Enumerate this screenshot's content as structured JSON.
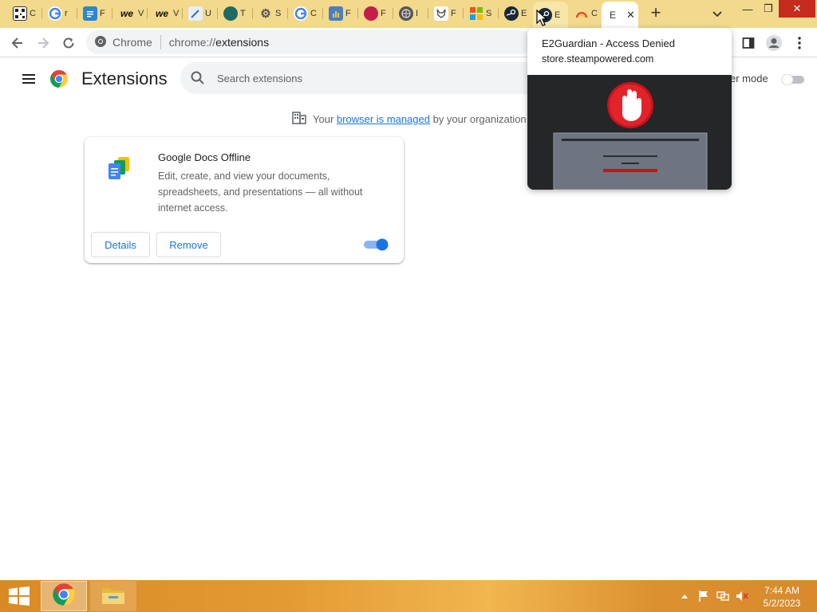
{
  "window": {
    "tabs": [
      {
        "favicon": "qr-icon",
        "title": "C"
      },
      {
        "favicon": "google-icon",
        "title": "r"
      },
      {
        "favicon": "docs-blue-icon",
        "title": "F"
      },
      {
        "favicon": "we-icon",
        "title": "V"
      },
      {
        "favicon": "we-icon",
        "title": "V"
      },
      {
        "favicon": "pen-icon",
        "title": "U"
      },
      {
        "favicon": "teal-circle-icon",
        "title": "T"
      },
      {
        "favicon": "gear-icon",
        "title": "S"
      },
      {
        "favicon": "google-icon",
        "title": "C"
      },
      {
        "favicon": "folder-chart-icon",
        "title": "F"
      },
      {
        "favicon": "red-circle-icon",
        "title": "F"
      },
      {
        "favicon": "globe-icon",
        "title": "I"
      },
      {
        "favicon": "fox-icon",
        "title": "F"
      },
      {
        "favicon": "microsoft-icon",
        "title": "S"
      },
      {
        "favicon": "steam-icon",
        "title": "E"
      },
      {
        "favicon": "steam-icon",
        "title": "E"
      },
      {
        "favicon": "rainbow-icon",
        "title": "C"
      },
      {
        "favicon": "",
        "title": "E"
      }
    ],
    "active_tab_title": "E",
    "new_tab_label": "+",
    "controls": {
      "minimize": "—",
      "restore": "❐",
      "close": "✕"
    }
  },
  "toolbar": {
    "site_chip": "Chrome",
    "url_prefix": "chrome://",
    "url_path": "extensions"
  },
  "extensions_page": {
    "title": "Extensions",
    "search_placeholder": "Search extensions",
    "dev_mode_label": "er mode",
    "dev_mode_on": false,
    "managed_notice": {
      "prefix": "Your",
      "link": "browser is managed",
      "suffix": "by your organization"
    },
    "extensions": [
      {
        "name": "Google Docs Offline",
        "description": "Edit, create, and view your documents, spreadsheets, and presentations — all without internet access.",
        "details_label": "Details",
        "remove_label": "Remove",
        "enabled": true
      }
    ]
  },
  "hovercard": {
    "title": "E2Guardian - Access Denied",
    "domain": "store.steampowered.com"
  },
  "taskbar": {
    "time": "7:44 AM",
    "date": "5/2/2023"
  },
  "colors": {
    "accent": "#1a73e8",
    "tabstrip": "#f2d98c",
    "taskbar": "#e49a33",
    "toggle_on": "#1a73e8",
    "toggle_off": "#bdc1c6"
  }
}
